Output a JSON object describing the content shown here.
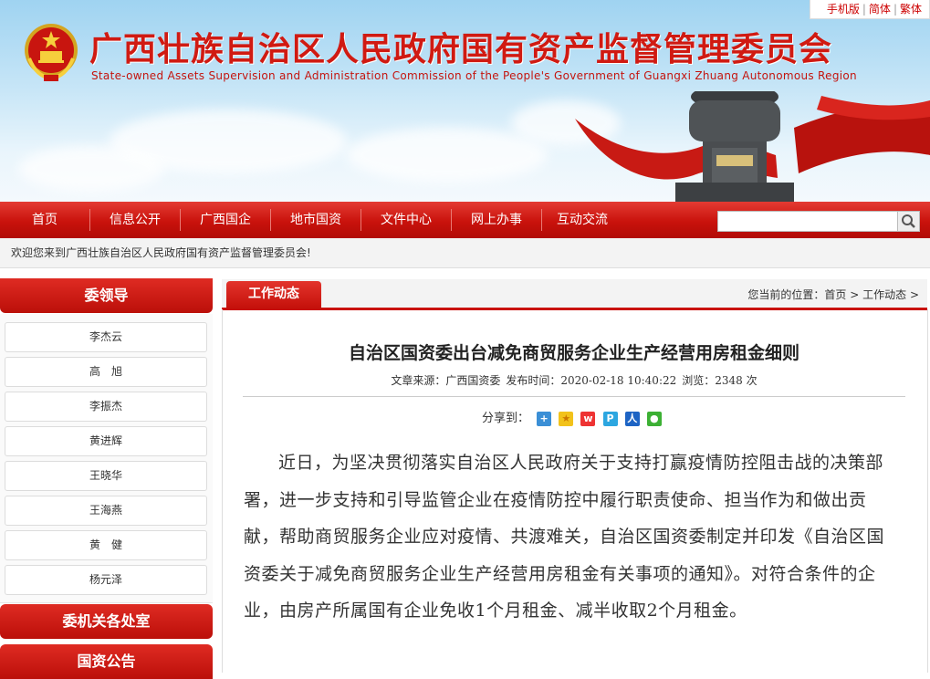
{
  "topbar": {
    "mobile": "手机版",
    "simplified": "简体",
    "traditional": "繁体"
  },
  "header": {
    "title_cn": "广西壮族自治区人民政府国有资产监督管理委员会",
    "title_en": "State-owned Assets Supervision and Administration Commission of the People's Government of Guangxi Zhuang Autonomous Region"
  },
  "nav": {
    "items": [
      "首页",
      "信息公开",
      "广西国企",
      "地市国资",
      "文件中心",
      "网上办事",
      "互动交流"
    ]
  },
  "search": {
    "placeholder": ""
  },
  "welcome": "欢迎您来到广西壮族自治区人民政府国有资产监督管理委员会!",
  "sidebar": {
    "leaders_title": "委领导",
    "leaders": [
      "李杰云",
      "高　旭",
      "李振杰",
      "黄进辉",
      "王晓华",
      "王海燕",
      "黄　健",
      "杨元泽"
    ],
    "section2": "委机关各处室",
    "section3": "国资公告"
  },
  "main": {
    "tab": "工作动态",
    "breadcrumb_prefix": "您当前的位置：",
    "breadcrumb_home": "首页",
    "breadcrumb_sep1": " > ",
    "breadcrumb_current": "工作动态",
    "breadcrumb_sep2": " >",
    "article_title": "自治区国资委出台减免商贸服务企业生产经营用房租金细则",
    "source_label": "文章来源：",
    "source": "广西国资委",
    "time_label": "发布时间：",
    "time": "2020-02-18 10:40:22",
    "views_label": "浏览：",
    "views": "2348",
    "views_unit": "次",
    "share_label": "分享到：",
    "body": "近日，为坚决贯彻落实自治区人民政府关于支持打赢疫情防控阻击战的决策部署，进一步支持和引导监管企业在疫情防控中履行职责使命、担当作为和做出贡献，帮助商贸服务企业应对疫情、共渡难关，自治区国资委制定并印发《自治区国资委关于减免商贸服务企业生产经营用房租金有关事项的通知》。对符合条件的企业，由房产所属国有企业免收1个月租金、减半收取2个月租金。"
  },
  "colors": {
    "primary_red": "#c9120c",
    "title_red": "#d01a12"
  },
  "icons": [
    "emblem-icon",
    "search-icon",
    "share-plus-icon",
    "share-qzone-icon",
    "share-weibo-icon",
    "share-tencent-icon",
    "share-renren-icon",
    "share-wechat-icon"
  ]
}
